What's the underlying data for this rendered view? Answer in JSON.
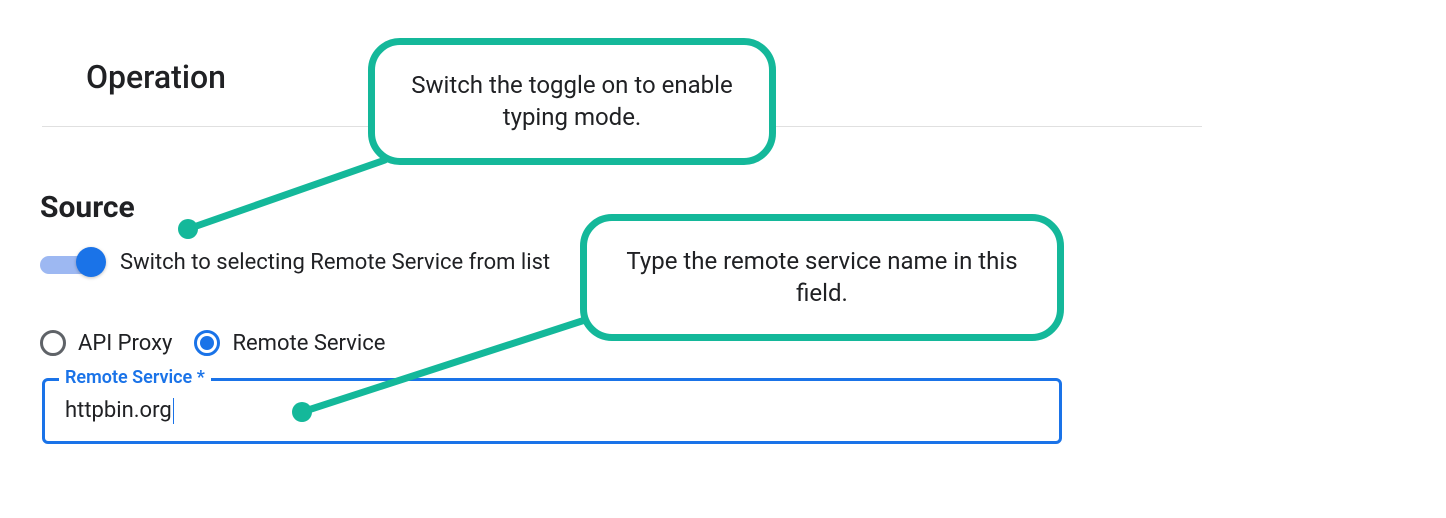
{
  "operation_heading": "Operation",
  "source_heading": "Source",
  "toggle": {
    "label": "Switch to selecting Remote Service from list",
    "on": true
  },
  "radios": {
    "api_proxy": {
      "label": "API Proxy",
      "selected": false
    },
    "remote_service": {
      "label": "Remote Service",
      "selected": true
    }
  },
  "field": {
    "legend": "Remote Service *",
    "value": "httpbin.org"
  },
  "callouts": {
    "toggle_help": "Switch the toggle on to enable typing mode.",
    "field_help": "Type the remote service name in this field."
  },
  "colors": {
    "accent": "#1a73e8",
    "callout": "#14b89a"
  }
}
